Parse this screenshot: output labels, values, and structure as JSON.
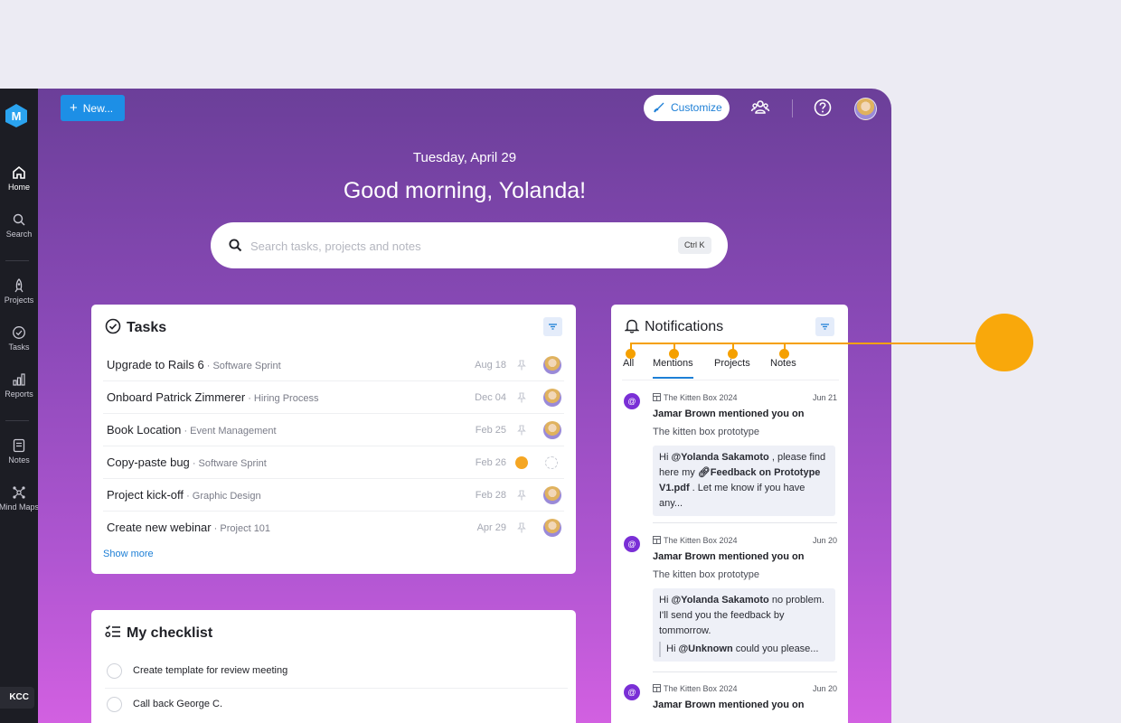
{
  "sidebar": {
    "items": [
      {
        "label": "Home",
        "icon": "home-icon"
      },
      {
        "label": "Search",
        "icon": "search-icon"
      },
      {
        "label": "Projects",
        "icon": "rocket-icon"
      },
      {
        "label": "Tasks",
        "icon": "check-circle-icon"
      },
      {
        "label": "Reports",
        "icon": "bar-chart-icon"
      },
      {
        "label": "Notes",
        "icon": "note-icon"
      },
      {
        "label": "Mind Maps",
        "icon": "mind-map-icon"
      }
    ],
    "badge": "KCC"
  },
  "header": {
    "new_label": "New...",
    "customize_label": "Customize"
  },
  "hero": {
    "date": "Tuesday, April 29",
    "greeting": "Good morning, Yolanda!"
  },
  "search": {
    "placeholder": "Search tasks, projects and notes",
    "shortcut": "Ctrl K"
  },
  "tasks": {
    "title": "Tasks",
    "show_more": "Show more",
    "rows": [
      {
        "name": "Upgrade to Rails 6",
        "project": " · Software Sprint",
        "due": "Aug 18"
      },
      {
        "name": "Onboard Patrick Zimmerer",
        "project": " · Hiring Process",
        "due": "Dec 04"
      },
      {
        "name": "Book Location",
        "project": " · Event Management",
        "due": "Feb 25"
      },
      {
        "name": "Copy-paste bug",
        "project": " · Software Sprint",
        "due": "Feb 26"
      },
      {
        "name": "Project kick-off",
        "project": " · Graphic Design",
        "due": "Feb 28"
      },
      {
        "name": "Create new webinar",
        "project": " · Project 101",
        "due": "Apr 29"
      }
    ]
  },
  "checklist": {
    "title": "My checklist",
    "items": [
      "Create template for review meeting",
      "Call back George C."
    ]
  },
  "notifications": {
    "title": "Notifications",
    "tabs": [
      "All",
      "Mentions",
      "Projects",
      "Notes"
    ],
    "items": [
      {
        "source": "The Kitten Box 2024",
        "date": "Jun 21",
        "who": "Jamar Brown mentioned you on",
        "what": "The kitten box prototype",
        "q1": "Hi ",
        "q_mention": "@Yolanda Sakamoto",
        "q2": " , please find here my ",
        "q_file": "Feedback on Prototype V1.pdf",
        "q3": " . Let me know if you have any..."
      },
      {
        "source": "The Kitten Box 2024",
        "date": "Jun 20",
        "who": "Jamar Brown mentioned you on",
        "what": "The kitten box prototype",
        "q1": "Hi ",
        "q_mention": "@Yolanda Sakamoto",
        "q2": " no problem. I'll send you the feedback by tommorrow.",
        "r1": "Hi ",
        "r_mention": "@Unknown",
        "r2": " could you please..."
      },
      {
        "source": "The Kitten Box 2024",
        "date": "Jun 20",
        "who": "Jamar Brown mentioned you on"
      }
    ]
  },
  "colors": {
    "accent": "#1d8fe6",
    "callout": "#f5a000",
    "mention_badge": "#7a2fd6",
    "sidebar_bg": "#1c1d24"
  }
}
